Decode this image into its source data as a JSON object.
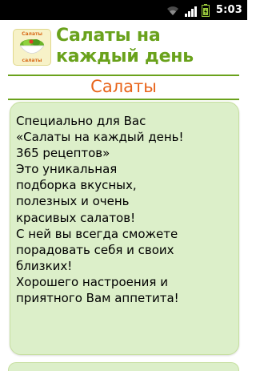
{
  "status_bar": {
    "time": "5:03",
    "icons": [
      "wifi-icon",
      "signal-icon",
      "battery-charging-icon"
    ]
  },
  "header": {
    "app_title": "Салаты на каждый день",
    "logo_text_top": "Салаты",
    "logo_text_bottom": "салаты"
  },
  "section": {
    "title": "Салаты"
  },
  "card": {
    "description": "Специально для Вас\n«Салаты на каждый день!\n365 рецептов»\nЭто уникальная\nподборка вкусных,\nполезных и очень\nкрасивых салатов!\nС ней вы всегда сможете\nпорадовать себя и своих\nблизких!\nХорошего настроения и\nприятного Вам аппетита!"
  },
  "colors": {
    "accent_green": "#6aa21c",
    "accent_orange": "#e8641a",
    "card_background": "#dcefc9"
  }
}
